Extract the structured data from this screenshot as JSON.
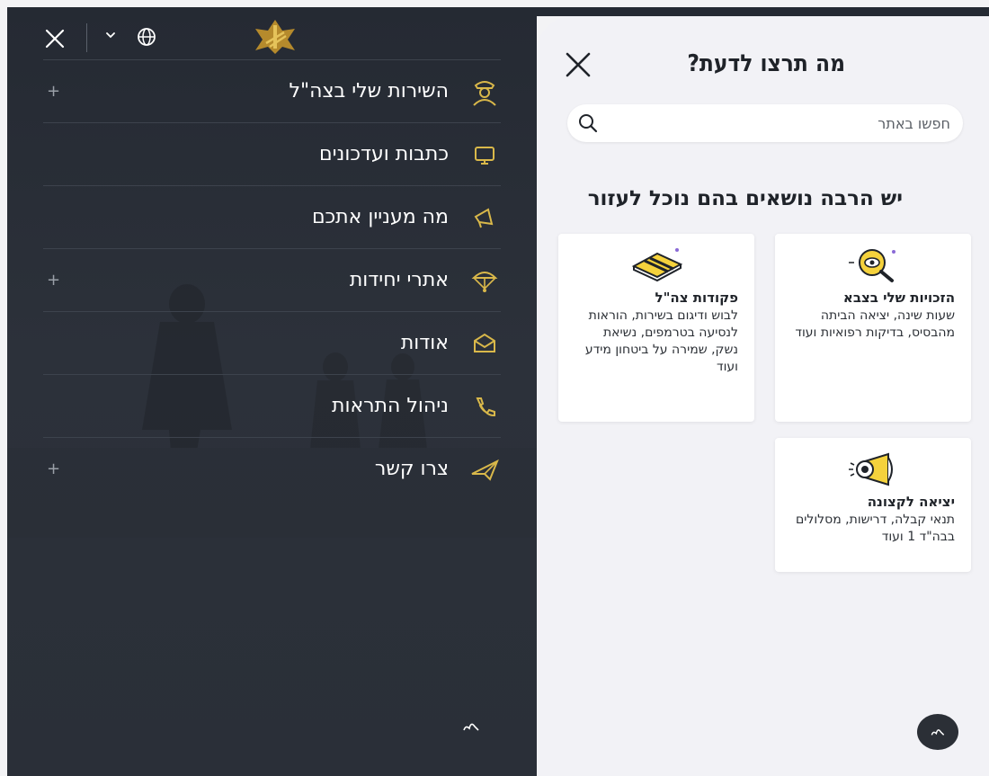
{
  "menu_panel": {
    "items": [
      {
        "label": "השירות שלי בצה\"ל",
        "icon": "soldier-icon",
        "expandable": true
      },
      {
        "label": "כתבות ועדכונים",
        "icon": "monitor-icon",
        "expandable": false
      },
      {
        "label": "מה מעניין אתכם",
        "icon": "megaphone-icon",
        "expandable": false
      },
      {
        "label": "אתרי יחידות",
        "icon": "parachute-icon",
        "expandable": true
      },
      {
        "label": "אודות",
        "icon": "envelope-icon",
        "expandable": false
      },
      {
        "label": "ניהול התראות",
        "icon": "phone-icon",
        "expandable": false
      },
      {
        "label": "צרו קשר",
        "icon": "paper-plane-icon",
        "expandable": true
      }
    ],
    "plus_symbol": "+"
  },
  "search_panel": {
    "title": "מה תרצו לדעת?",
    "search_placeholder": "חפשו באתר",
    "subtitle": "יש הרבה נושאים בהם נוכל לעזור",
    "cards": [
      {
        "title": "הזכויות שלי בצבא",
        "description": "שעות שינה, יציאה הביתה מהבסיס, בדיקות רפואיות ועוד",
        "icon": "magnifier-eye-icon"
      },
      {
        "title": "פקודות צה\"ל",
        "description": "לבוש ודיגום בשירות, הוראות לנסיעה בטרמפים, נשיאת נשק, שמירה על ביטחון מידע ועוד",
        "icon": "notebook-icon"
      },
      {
        "title": "יציאה לקצונה",
        "description": "תנאי קבלה, דרישות, מסלולים בבה\"ד 1 ועוד",
        "icon": "megaphone-icon"
      }
    ]
  },
  "colors": {
    "dark_bg": "#252a33",
    "accent_gold": "#d9b84a",
    "light_bg": "#f2f2f6",
    "card_yellow": "#f5d23c"
  }
}
